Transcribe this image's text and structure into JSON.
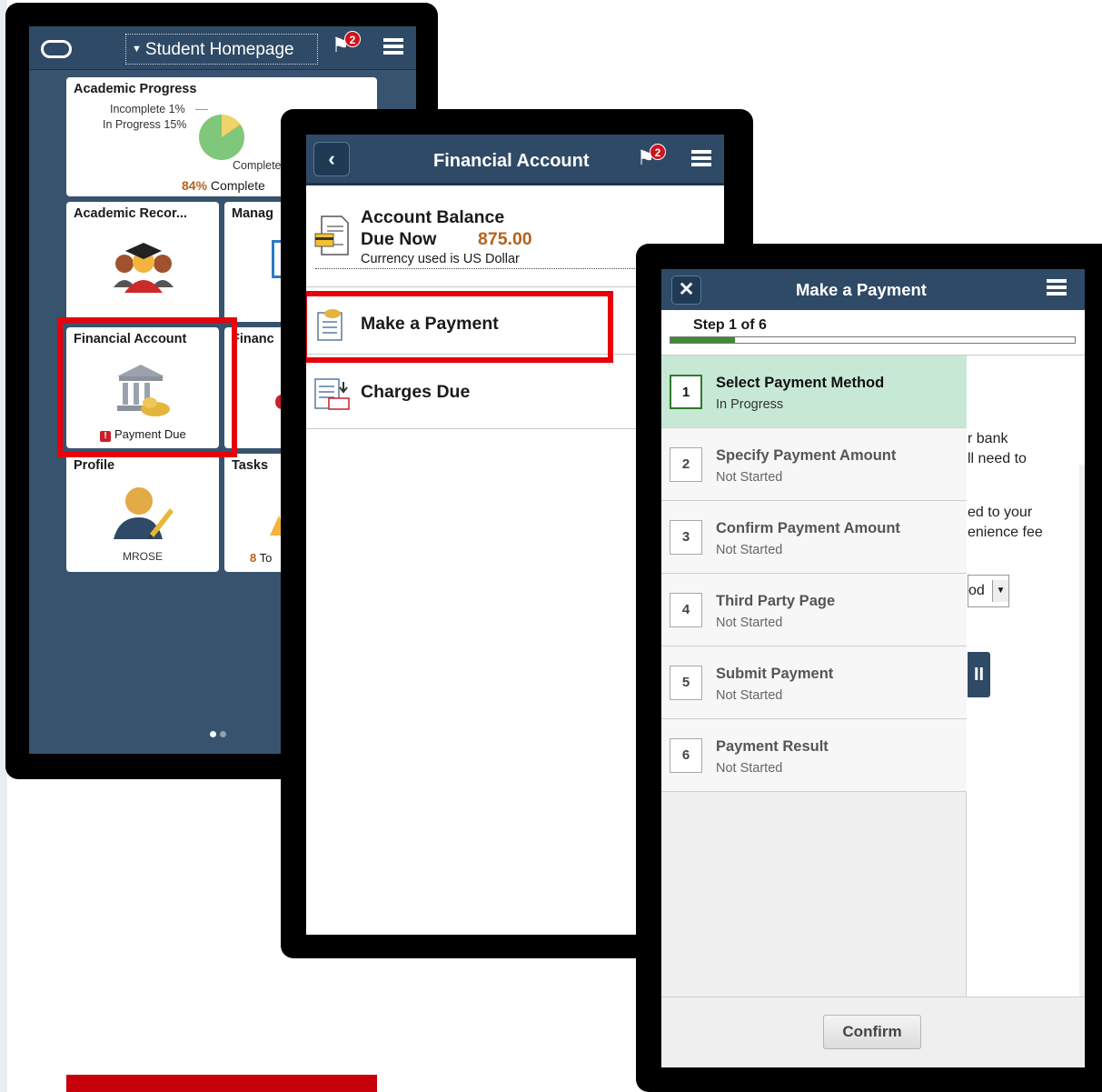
{
  "homepage": {
    "title": "Student Homepage",
    "notification_count": "2",
    "tiles": {
      "academic_progress": {
        "title": "Academic Progress",
        "legend_incomplete": "Incomplete 1%",
        "legend_in_progress": "In Progress 15%",
        "legend_complete": "Complete",
        "percent": "84%",
        "percent_label": "Complete",
        "chart_values": {
          "incomplete": 1,
          "in_progress": 15,
          "complete": 84
        }
      },
      "academic_records": {
        "title": "Academic Recor..."
      },
      "manage": {
        "title": "Manag"
      },
      "financial_account": {
        "title": "Financial Account",
        "alert": "Payment Due"
      },
      "financial_aid": {
        "title": "Financ"
      },
      "profile": {
        "title": "Profile",
        "username": "MROSE"
      },
      "tasks": {
        "title": "Tasks",
        "count": "8",
        "count_label": "To"
      }
    }
  },
  "financial_account": {
    "title": "Financial Account",
    "notification_count": "2",
    "balance": {
      "title": "Account Balance",
      "due_label": "Due Now",
      "amount": "875.00",
      "currency_note": "Currency used is US Dollar"
    },
    "make_payment": "Make a Payment",
    "charges_due": "Charges Due"
  },
  "make_payment": {
    "title": "Make a Payment",
    "step_indicator": "Step 1 of 6",
    "progress_fraction": 0.16,
    "background_text": [
      "r bank",
      "ll need to",
      "ed to your",
      "enience fee"
    ],
    "dropdown_fragment": "od",
    "steps": [
      {
        "number": "1",
        "name": "Select Payment Method",
        "status": "In Progress"
      },
      {
        "number": "2",
        "name": "Specify Payment Amount",
        "status": "Not Started"
      },
      {
        "number": "3",
        "name": "Confirm Payment Amount",
        "status": "Not Started"
      },
      {
        "number": "4",
        "name": "Third Party Page",
        "status": "Not Started"
      },
      {
        "number": "5",
        "name": "Submit Payment",
        "status": "Not Started"
      },
      {
        "number": "6",
        "name": "Payment Result",
        "status": "Not Started"
      }
    ],
    "confirm_label": "Confirm"
  },
  "colors": {
    "header": "#2f4a66",
    "highlight_red": "#e8000b",
    "active_step": "#c8e8d6",
    "progress_green": "#3d8b38",
    "amount_orange": "#b4631b"
  }
}
